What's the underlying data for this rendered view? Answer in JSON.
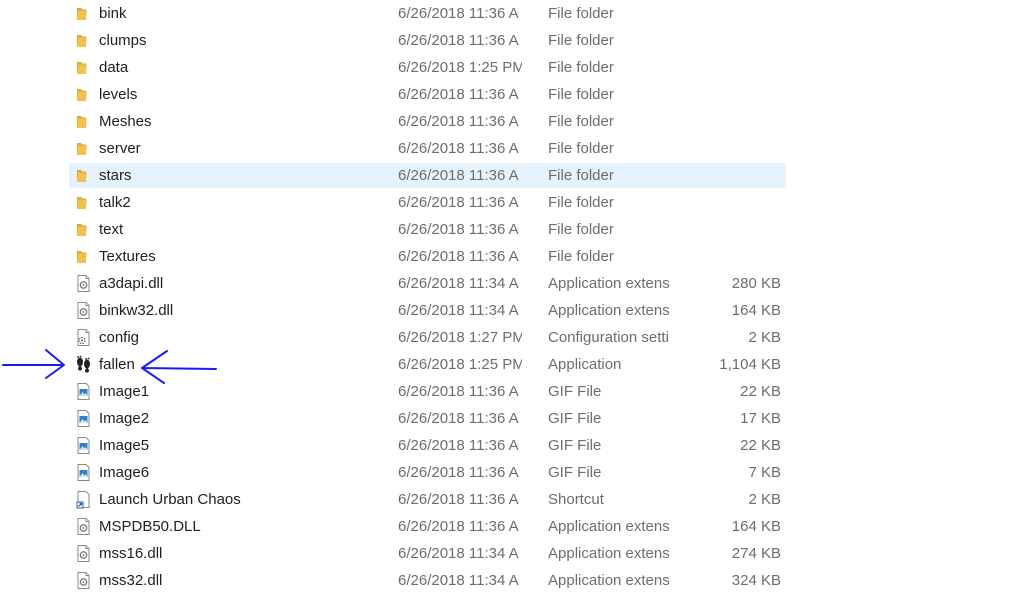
{
  "files": [
    {
      "name": "bink",
      "date": "6/26/2018 11:36 A",
      "type": "File folder",
      "size": "",
      "icon": "folder-icon"
    },
    {
      "name": "clumps",
      "date": "6/26/2018 11:36 A",
      "type": "File folder",
      "size": "",
      "icon": "folder-icon"
    },
    {
      "name": "data",
      "date": "6/26/2018 1:25 PM",
      "type": "File folder",
      "size": "",
      "icon": "folder-icon"
    },
    {
      "name": "levels",
      "date": "6/26/2018 11:36 A",
      "type": "File folder",
      "size": "",
      "icon": "folder-icon"
    },
    {
      "name": "Meshes",
      "date": "6/26/2018 11:36 A",
      "type": "File folder",
      "size": "",
      "icon": "folder-icon"
    },
    {
      "name": "server",
      "date": "6/26/2018 11:36 A",
      "type": "File folder",
      "size": "",
      "icon": "folder-icon"
    },
    {
      "name": "stars",
      "date": "6/26/2018 11:36 A",
      "type": "File folder",
      "size": "",
      "icon": "folder-icon",
      "selected": true
    },
    {
      "name": "talk2",
      "date": "6/26/2018 11:36 A",
      "type": "File folder",
      "size": "",
      "icon": "folder-icon"
    },
    {
      "name": "text",
      "date": "6/26/2018 11:36 A",
      "type": "File folder",
      "size": "",
      "icon": "folder-icon"
    },
    {
      "name": "Textures",
      "date": "6/26/2018 11:36 A",
      "type": "File folder",
      "size": "",
      "icon": "folder-icon"
    },
    {
      "name": "a3dapi.dll",
      "date": "6/26/2018 11:34 A",
      "type": "Application extens",
      "size": "280 KB",
      "icon": "dll-icon"
    },
    {
      "name": "binkw32.dll",
      "date": "6/26/2018 11:34 A",
      "type": "Application extens",
      "size": "164 KB",
      "icon": "dll-icon"
    },
    {
      "name": "config",
      "date": "6/26/2018 1:27 PM",
      "type": "Configuration setti",
      "size": "2 KB",
      "icon": "config-icon"
    },
    {
      "name": "fallen",
      "date": "6/26/2018 1:25 PM",
      "type": "Application",
      "size": "1,104 KB",
      "icon": "footprints-icon"
    },
    {
      "name": "Image1",
      "date": "6/26/2018 11:36 A",
      "type": "GIF File",
      "size": "22 KB",
      "icon": "image-icon"
    },
    {
      "name": "Image2",
      "date": "6/26/2018 11:36 A",
      "type": "GIF File",
      "size": "17 KB",
      "icon": "image-icon"
    },
    {
      "name": "Image5",
      "date": "6/26/2018 11:36 A",
      "type": "GIF File",
      "size": "22 KB",
      "icon": "image-icon"
    },
    {
      "name": "Image6",
      "date": "6/26/2018 11:36 A",
      "type": "GIF File",
      "size": "7 KB",
      "icon": "image-icon"
    },
    {
      "name": "Launch Urban Chaos",
      "date": "6/26/2018 11:36 A",
      "type": "Shortcut",
      "size": "2 KB",
      "icon": "shortcut-icon"
    },
    {
      "name": "MSPDB50.DLL",
      "date": "6/26/2018 11:36 A",
      "type": "Application extens",
      "size": "164 KB",
      "icon": "dll-icon"
    },
    {
      "name": "mss16.dll",
      "date": "6/26/2018 11:34 A",
      "type": "Application extens",
      "size": "274 KB",
      "icon": "dll-icon"
    },
    {
      "name": "mss32.dll",
      "date": "6/26/2018 11:34 A",
      "type": "Application extens",
      "size": "324 KB",
      "icon": "dll-icon"
    }
  ],
  "colors": {
    "folder": "#f2c14e",
    "selection": "#e5f3ff",
    "annotation": "#1a1aff"
  }
}
